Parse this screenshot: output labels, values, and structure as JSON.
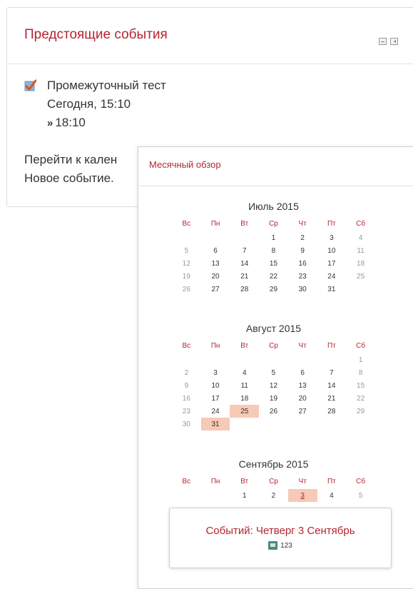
{
  "upcoming_block": {
    "title": "Предстоящие события",
    "event": {
      "name": "Промежуточный тест",
      "time": "Сегодня, 15:10",
      "end_time": "18:10",
      "end_prefix": "»"
    },
    "links": [
      {
        "label": "Перейти к кален"
      },
      {
        "label": "Новое событие."
      }
    ]
  },
  "popup": {
    "title": "Месячный обзор",
    "weekdays": [
      "Вс",
      "Пн",
      "Вт",
      "Ср",
      "Чт",
      "Пт",
      "Сб"
    ],
    "months": [
      {
        "caption": "Июль 2015",
        "weeks": [
          [
            "",
            "",
            "",
            "1",
            "2",
            "3",
            "4"
          ],
          [
            "5",
            "6",
            "7",
            "8",
            "9",
            "10",
            "11"
          ],
          [
            "12",
            "13",
            "14",
            "15",
            "16",
            "17",
            "18"
          ],
          [
            "19",
            "20",
            "21",
            "22",
            "23",
            "24",
            "25"
          ],
          [
            "26",
            "27",
            "28",
            "29",
            "30",
            "31",
            ""
          ]
        ],
        "highlighted": []
      },
      {
        "caption": "Август 2015",
        "weeks": [
          [
            "",
            "",
            "",
            "",
            "",
            "",
            "1"
          ],
          [
            "2",
            "3",
            "4",
            "5",
            "6",
            "7",
            "8"
          ],
          [
            "9",
            "10",
            "11",
            "12",
            "13",
            "14",
            "15"
          ],
          [
            "16",
            "17",
            "18",
            "19",
            "20",
            "21",
            "22"
          ],
          [
            "23",
            "24",
            "25",
            "26",
            "27",
            "28",
            "29"
          ],
          [
            "30",
            "31",
            "",
            "",
            "",
            "",
            ""
          ]
        ],
        "highlighted": [
          "25",
          "31"
        ]
      },
      {
        "caption": "Сентябрь 2015",
        "weeks": [
          [
            "",
            "",
            "1",
            "2",
            "3",
            "4",
            "5"
          ]
        ],
        "highlighted": [
          "3"
        ]
      }
    ],
    "tooltip": {
      "title": "Событий: Четверг 3 Сентябрь",
      "item_label": "123",
      "item_icon": "quiz-icon"
    }
  },
  "colors": {
    "accent": "#b5252f",
    "highlight": "#f7c9b7",
    "weekend": "#999999"
  }
}
